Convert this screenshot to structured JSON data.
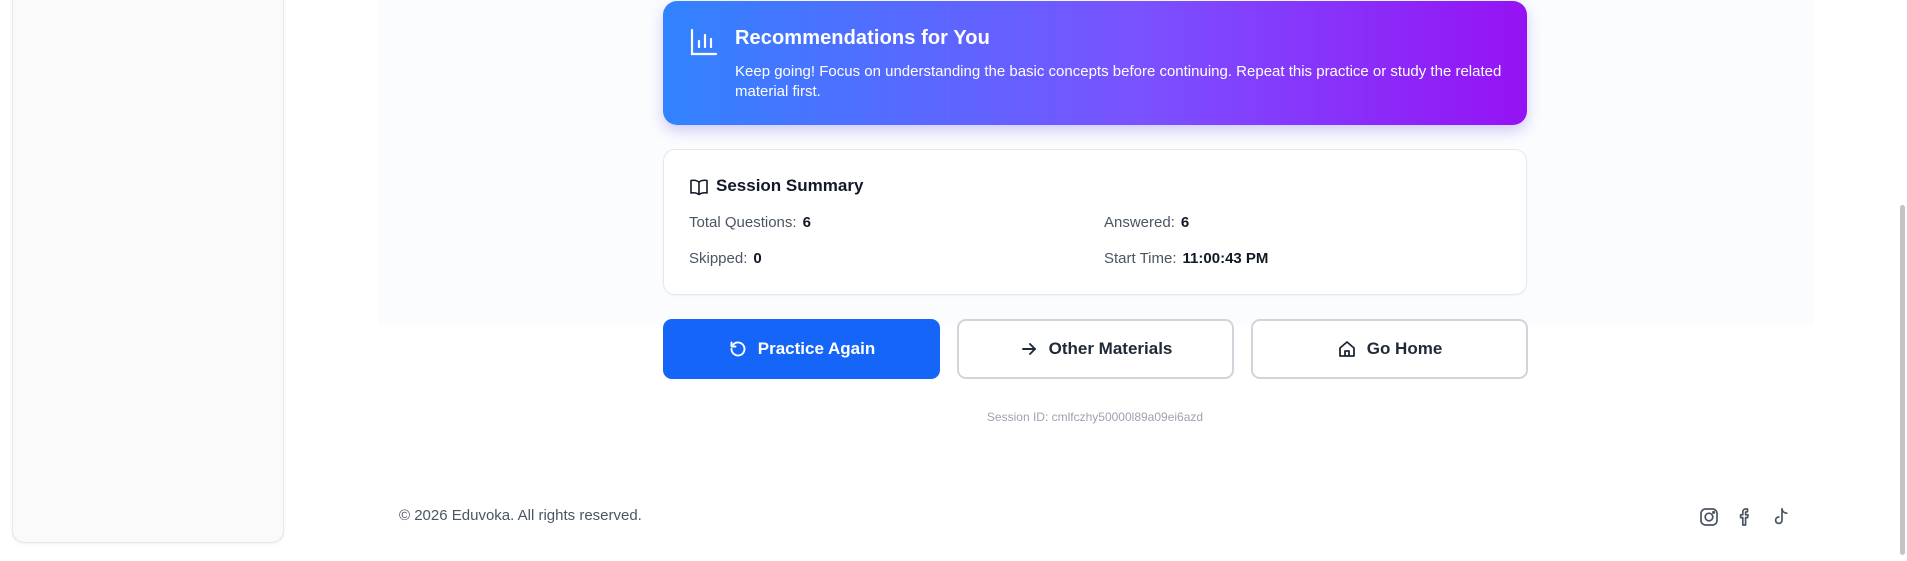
{
  "recommendations": {
    "title": "Recommendations for You",
    "text": "Keep going! Focus on understanding the basic concepts before continuing. Repeat this practice or study the related material first.",
    "icon": "bar-chart-icon"
  },
  "summary": {
    "title": "Session Summary",
    "icon": "book-open-icon",
    "total_label": "Total Questions:",
    "total_value": "6",
    "answered_label": "Answered:",
    "answered_value": "6",
    "skipped_label": "Skipped:",
    "skipped_value": "0",
    "start_label": "Start Time:",
    "start_value": "11:00:43 PM"
  },
  "actions": {
    "practice_again": "Practice Again",
    "other_materials": "Other Materials",
    "go_home": "Go Home"
  },
  "session_id": "Session ID: cmlfczhy50000l89a09ei6azd",
  "footer": {
    "copyright": "© 2026 Eduvoka.  All rights reserved.",
    "social": [
      "instagram-icon",
      "facebook-icon",
      "tiktok-icon"
    ]
  },
  "colors": {
    "primary": "#1565f8",
    "gradient_start": "#3183ff",
    "gradient_end": "#9612f4"
  }
}
